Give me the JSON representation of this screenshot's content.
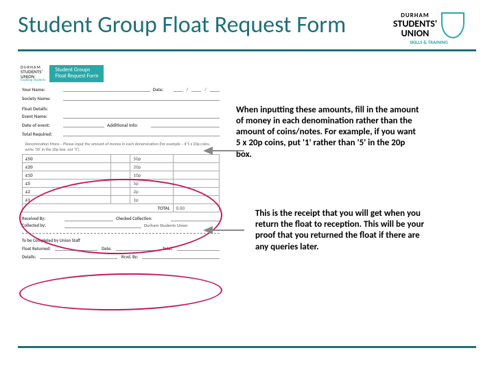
{
  "header": {
    "title": "Student Group Float Request Form",
    "logo_line1": "DURHAM",
    "logo_line2": "STUDENTS'",
    "logo_line3": "UNION",
    "logo_sub": "SKILLS & TRAINING"
  },
  "form": {
    "logo_line1": "DURHAM",
    "logo_line2": "STUDENTS'",
    "logo_line3": "UNION",
    "logo_sub": "Enabling Students",
    "title_line1": "Student Groups",
    "title_line2": "Float Request Form",
    "labels": {
      "your_name": "Your Name:",
      "date": "Date:",
      "society_name": "Society Name:",
      "float_details": "Float Details:",
      "event_name": "Event Name:",
      "date_of_event": "Date of event:",
      "additional_info": "Additional Info:",
      "total_required": "Total Required:",
      "instruction": "Denomination Mons – Please input the amount of money in each denomination (for example – if 5 x 20p coins, write '50' in the 20p box, not '5').",
      "received_by": "Received By:",
      "checked_collection": "Checked Collection:",
      "collected_by": "Collected by:",
      "durham_students_union": "Durham Students Union",
      "to_be_completed": "To be Completed by Union Staff",
      "float_returned": "Float Returned:",
      "date2": "Date:",
      "total2": "Total:",
      "details": "Details:",
      "rcvd_by": "Rcvd. By:"
    },
    "denom_rows": [
      [
        "£50",
        "50p"
      ],
      [
        "£20",
        "20p"
      ],
      [
        "£10",
        "10p"
      ],
      [
        "£5",
        "5p"
      ],
      [
        "£2",
        "2p"
      ],
      [
        "£1",
        "1p"
      ]
    ],
    "total_label": "TOTAL",
    "total_value": "0.00"
  },
  "notes": {
    "note1": "When inputting these amounts, fill in the amount of money in each denomination rather than the amount of coins/notes. For example, if you want 5 x 20p coins, put '1' rather than '5' in the 20p box.",
    "note2": "This is the receipt that you will get when you return the float to reception. This will be your proof that you returned the float if there are any queries later."
  }
}
